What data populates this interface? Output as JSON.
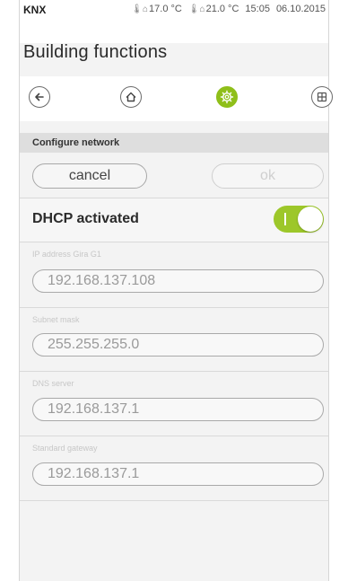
{
  "status": {
    "app": "KNX",
    "temp_inside": "17.0 °C",
    "temp_outside": "21.0 °C",
    "time": "15:05",
    "date": "06.10.2015",
    "inside_icon": "thermometer-inside-icon",
    "outside_icon": "thermometer-outside-icon"
  },
  "page": {
    "title": "Building functions"
  },
  "nav": {
    "back_icon": "back-arrow-icon",
    "home_icon": "home-icon",
    "settings_icon": "settings-gear-icon",
    "grid_icon": "grid-icon",
    "active": "settings"
  },
  "section": {
    "header": "Configure network"
  },
  "actions": {
    "cancel_label": "cancel",
    "ok_label": "ok"
  },
  "dhcp": {
    "label": "DHCP activated",
    "enabled": true
  },
  "fields": [
    {
      "label": "IP address Gira G1",
      "value": "192.168.137.108"
    },
    {
      "label": "Subnet mask",
      "value": "255.255.255.0"
    },
    {
      "label": "DNS server",
      "value": "192.168.137.1"
    },
    {
      "label": "Standard gateway",
      "value": "192.168.137.1"
    }
  ],
  "colors": {
    "accent": "#8fbf1a",
    "toggle_on": "#9dc72a",
    "section_header_bg": "#dedede"
  }
}
